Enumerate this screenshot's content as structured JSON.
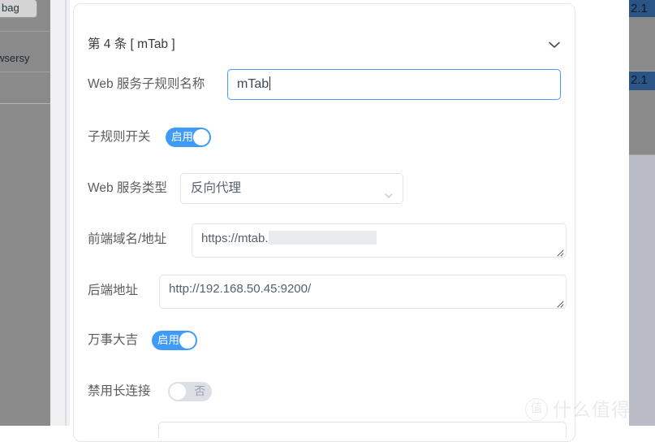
{
  "background": {
    "left_panel": {
      "tab_label": "bag",
      "list_text": "wsersy"
    },
    "right_edge_badges": [
      {
        "label": "2.1"
      },
      {
        "label": "2.1"
      }
    ]
  },
  "card": {
    "title": "第 4 条 [ mTab ]",
    "collapse_icon": "chevron-down-icon",
    "rows": {
      "rule_name": {
        "label": "Web 服务子规则名称",
        "value": "mTab",
        "focused": true
      },
      "rule_switch": {
        "label": "子规则开关",
        "state_label": "启用",
        "on": true
      },
      "service_type": {
        "label": "Web 服务类型",
        "value": "反向代理",
        "arrow_icon": "chevron-down-icon"
      },
      "frontend_domain": {
        "label": "前端域名/地址",
        "value": "https://mtab.",
        "redacted": true
      },
      "backend_address": {
        "label": "后端地址",
        "value": "http://192.168.50.45:9200/"
      },
      "wansheng": {
        "label": "万事大吉",
        "state_label": "启用",
        "on": true
      },
      "disable_keepalive": {
        "label": "禁用长连接",
        "state_label": "否",
        "on": false
      }
    }
  },
  "watermark": {
    "badge": "值",
    "text": "什么值得买"
  },
  "colors": {
    "accent_blue": "#409eff",
    "switch_on": "#3f9bf7",
    "switch_off": "#dcdfe6",
    "border": "#e2e4ea",
    "label_text": "#5c5c5c",
    "badge_blue": "#2b5585"
  }
}
